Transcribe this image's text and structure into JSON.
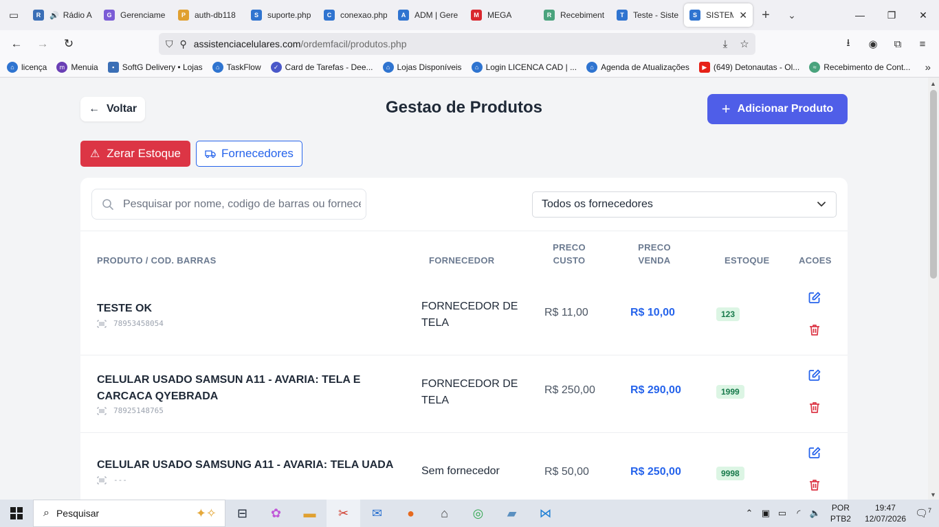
{
  "browser": {
    "tabs": [
      {
        "label": "Rádio A",
        "color": "#3b6fb6",
        "glyph": "R"
      },
      {
        "label": "Gerenciame",
        "color": "#7b5cd6",
        "glyph": "G"
      },
      {
        "label": "auth-db118",
        "color": "#e0a030",
        "glyph": "P"
      },
      {
        "label": "suporte.php",
        "color": "#2f74d0",
        "glyph": "S"
      },
      {
        "label": "conexao.php",
        "color": "#2f74d0",
        "glyph": "C"
      },
      {
        "label": "ADM | Gere",
        "color": "#2f74d0",
        "glyph": "A"
      },
      {
        "label": "MEGA",
        "color": "#d9272e",
        "glyph": "M"
      },
      {
        "label": "Recebiment",
        "color": "#4aa37d",
        "glyph": "R"
      },
      {
        "label": "Teste - Siste",
        "color": "#2f74d0",
        "glyph": "T"
      },
      {
        "label": "SISTEMA",
        "color": "#2f74d0",
        "glyph": "S"
      }
    ],
    "url_host": "assistenciacelulares.com",
    "url_path": "/ordemfacil/produtos.php",
    "bookmarks": [
      {
        "label": "licença",
        "color": "#2f74d0"
      },
      {
        "label": "Menuia",
        "color": "#6a3fb5"
      },
      {
        "label": "SoftG Delivery • Lojas",
        "color": "#3b6fb6"
      },
      {
        "label": "TaskFlow",
        "color": "#2f74d0"
      },
      {
        "label": "Card de Tarefas - Dee...",
        "color": "#4a58c9"
      },
      {
        "label": "Lojas Disponíveis",
        "color": "#2f74d0"
      },
      {
        "label": "Login LICENCA CAD  | ...",
        "color": "#2f74d0"
      },
      {
        "label": "Agenda de Atualizações",
        "color": "#2f74d0"
      },
      {
        "label": "(649) Detonautas - Ol...",
        "color": "#e62117"
      },
      {
        "label": "Recebimento de Cont...",
        "color": "#4aa37d"
      }
    ]
  },
  "page": {
    "back_label": "Voltar",
    "title": "Gestao de Produtos",
    "add_label": "Adicionar Produto",
    "zero_label": "Zerar Estoque",
    "suppliers_label": "Fornecedores",
    "search_placeholder": "Pesquisar por nome, codigo de barras ou fornecedor",
    "filter_value": "Todos os fornecedores",
    "columns": {
      "product": "PRODUTO / COD. BARRAS",
      "supplier": "FORNECEDOR",
      "cost_1": "PRECO",
      "cost_2": "CUSTO",
      "sale_1": "PRECO",
      "sale_2": "VENDA",
      "stock": "ESTOQUE",
      "actions": "ACOES"
    },
    "rows": [
      {
        "name": "TESTE OK",
        "barcode": "78953458054",
        "supplier": "FORNECEDOR DE TELA",
        "cost": "R$ 11,00",
        "sale": "R$ 10,00",
        "stock": "123"
      },
      {
        "name": "CELULAR USADO SAMSUN A11 - AVARIA: TELA E CARCACA QYEBRADA",
        "barcode": "78925148765",
        "supplier": "FORNECEDOR DE TELA",
        "cost": "R$ 250,00",
        "sale": "R$ 290,00",
        "stock": "1999"
      },
      {
        "name": "CELULAR USADO SAMSUNG A11 - AVARIA: TELA UADA",
        "barcode": "---",
        "supplier": "Sem fornecedor",
        "cost": "R$ 50,00",
        "sale": "R$ 250,00",
        "stock": "9998"
      }
    ]
  },
  "taskbar": {
    "search_label": "Pesquisar",
    "lang_1": "POR",
    "lang_2": "PTB2",
    "time": "19:47",
    "date": "12/07/2026",
    "notif_count": "7"
  }
}
